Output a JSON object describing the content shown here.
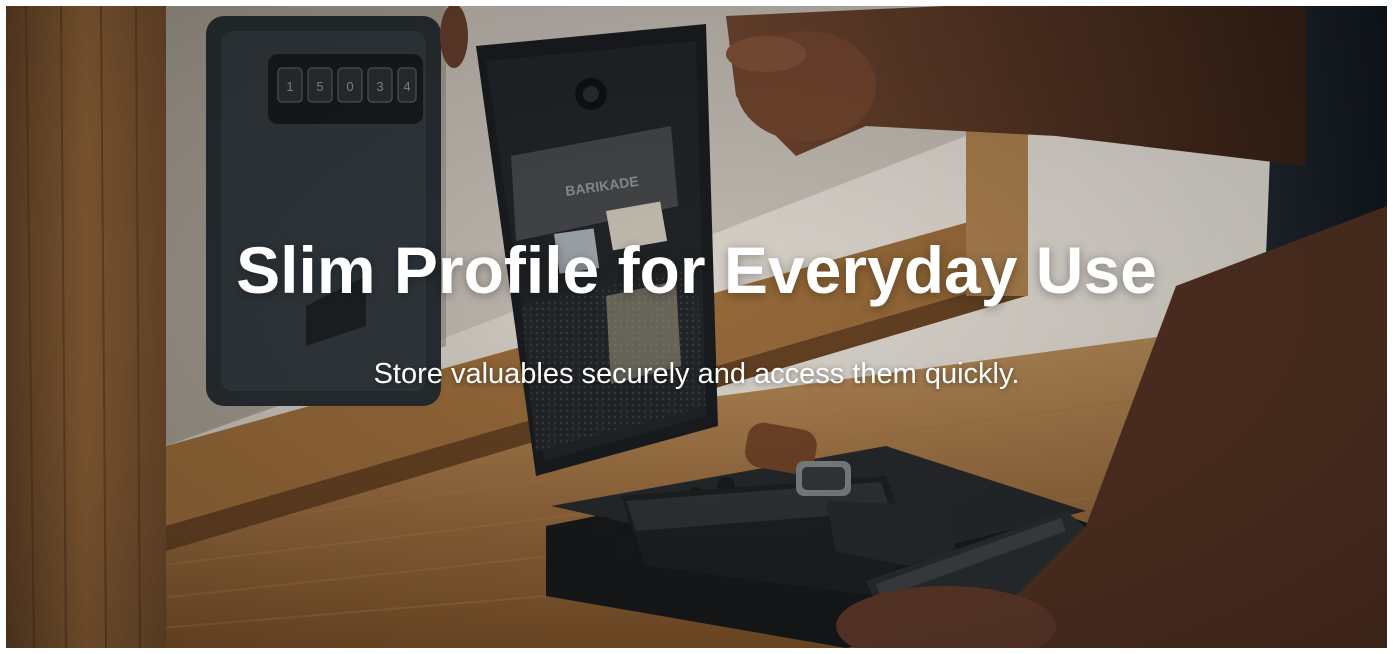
{
  "hero": {
    "headline": "Slim Profile for Everyday Use",
    "subheadline": "Store valuables securely and access them quickly.",
    "safe_brand_label": "BARIKADE",
    "keypad_keys": [
      "1",
      "5",
      "0",
      "3",
      "4"
    ]
  },
  "colors": {
    "text": "#ffffff",
    "wood": "#a6743f",
    "safe_body": "#1e2225"
  }
}
